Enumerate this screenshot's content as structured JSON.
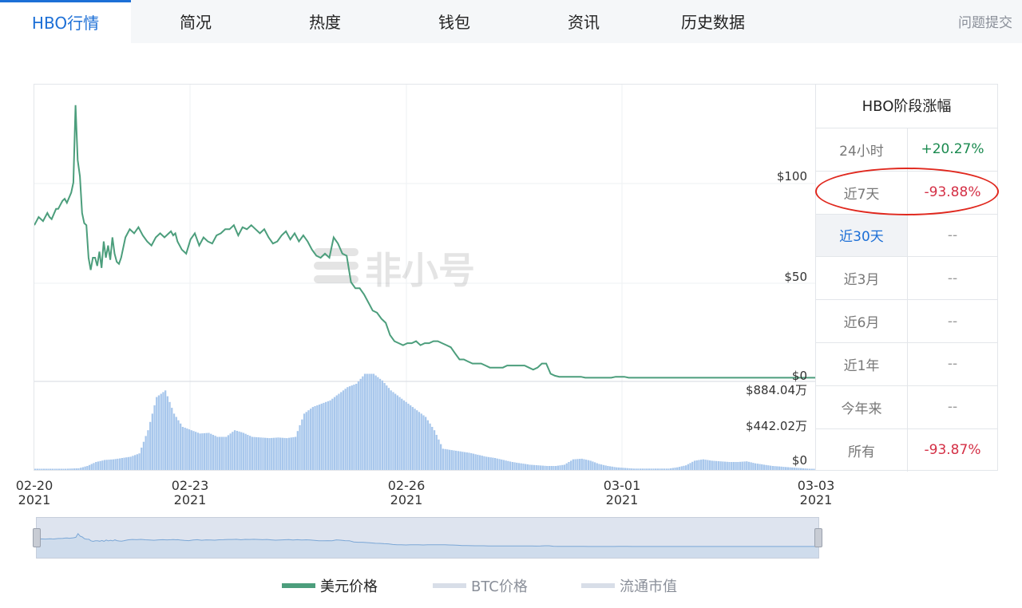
{
  "tabs": [
    {
      "label": "HBO行情",
      "active": true
    },
    {
      "label": "简况",
      "active": false
    },
    {
      "label": "热度",
      "active": false
    },
    {
      "label": "钱包",
      "active": false
    },
    {
      "label": "资讯",
      "active": false
    },
    {
      "label": "历史数据",
      "active": false
    }
  ],
  "feedback_label": "问题提交",
  "watermark": "非小号",
  "colors": {
    "price_line": "#4c9e7c",
    "volume_bar": "#a8c7ec",
    "up": "#1a8a4f",
    "down": "#d42f45",
    "accent": "#1c6fd6"
  },
  "chart_data": {
    "type": "line",
    "price_axis": {
      "ticks": [
        "$100",
        "$50",
        "$0"
      ],
      "values": [
        100,
        50,
        0
      ],
      "ylim": [
        0,
        135
      ]
    },
    "volume_axis": {
      "ticks": [
        "$884.04万",
        "$442.02万",
        "$0"
      ],
      "values": [
        884.04,
        442.02,
        0
      ],
      "unit": "万"
    },
    "x_labels": [
      {
        "date": "02-20",
        "year": "2021"
      },
      {
        "date": "02-23",
        "year": "2021"
      },
      {
        "date": "02-26",
        "year": "2021"
      },
      {
        "date": "03-01",
        "year": "2021"
      },
      {
        "date": "03-03",
        "year": "2021"
      }
    ],
    "x_range": [
      0,
      360
    ],
    "price_series": {
      "name": "美元价格",
      "x": [
        0,
        2,
        4,
        6,
        7,
        8,
        10,
        11,
        12,
        13,
        14,
        15,
        17,
        18,
        19,
        20,
        21,
        22,
        23,
        24,
        25,
        26,
        27,
        28,
        29,
        30,
        31,
        32,
        33,
        34,
        35,
        36,
        37,
        38,
        39,
        40,
        42,
        44,
        46,
        48,
        50,
        52,
        54,
        56,
        58,
        60,
        62,
        63,
        64,
        65,
        66,
        68,
        70,
        72,
        74,
        76,
        78,
        80,
        82,
        84,
        86,
        88,
        90,
        92,
        94,
        96,
        98,
        100,
        102,
        104,
        106,
        108,
        110,
        112,
        114,
        116,
        118,
        120,
        122,
        124,
        126,
        128,
        130,
        132,
        134,
        136,
        138,
        140,
        142,
        144,
        146,
        148,
        150,
        152,
        154,
        156,
        158,
        160,
        162,
        164,
        166,
        168,
        170,
        172,
        174,
        176,
        178,
        180,
        182,
        184,
        186,
        188,
        190,
        192,
        194,
        196,
        198,
        200,
        202,
        204,
        206,
        208,
        210,
        212,
        214,
        216,
        218,
        220,
        222,
        224,
        226,
        228,
        230,
        232,
        234,
        236,
        238,
        240,
        242,
        244,
        246,
        248,
        250,
        252,
        254,
        256,
        258,
        260,
        262,
        264,
        266,
        268,
        270,
        272,
        274,
        276,
        278,
        280,
        282,
        284,
        286,
        288,
        290,
        292,
        294,
        296,
        298,
        300,
        302,
        304,
        306,
        308,
        310,
        312,
        314,
        316,
        318,
        320,
        322,
        324,
        326,
        328,
        330,
        332,
        334,
        336,
        338,
        340,
        342,
        344,
        346,
        348,
        350,
        352,
        354,
        356,
        358,
        360
      ],
      "values": [
        76,
        80,
        78,
        82,
        80,
        79,
        84,
        84,
        86,
        88,
        89,
        87,
        92,
        97,
        135,
        108,
        100,
        82,
        77,
        76,
        60,
        54,
        60,
        60,
        56,
        63,
        55,
        68,
        60,
        66,
        59,
        70,
        62,
        58,
        57,
        60,
        70,
        74,
        72,
        75,
        71,
        68,
        66,
        70,
        72,
        70,
        72,
        73,
        71,
        72,
        68,
        64,
        62,
        69,
        72,
        66,
        70,
        68,
        67,
        71,
        72,
        74,
        74,
        76,
        71,
        75,
        74,
        76,
        74,
        72,
        74,
        70,
        67,
        68,
        71,
        73,
        69,
        72,
        68,
        71,
        68,
        64,
        61,
        60,
        62,
        60,
        70,
        67,
        62,
        61,
        48,
        45,
        45,
        42,
        38,
        34,
        33,
        30,
        28,
        22,
        19,
        18,
        17,
        18,
        18,
        19,
        17,
        18,
        18,
        19,
        19,
        18,
        17,
        16,
        13,
        10,
        10,
        9,
        8,
        8,
        8,
        7,
        6,
        6,
        6,
        6,
        7,
        7,
        7,
        7,
        7,
        6,
        5,
        6,
        8,
        8,
        3,
        2,
        1.5,
        1.5,
        1.5,
        1.5,
        1.5,
        1.5,
        1,
        1,
        1,
        1,
        1,
        1,
        1,
        1.5,
        1.5,
        1.5,
        1,
        1,
        1,
        1,
        1,
        1,
        1,
        1,
        1,
        1,
        1,
        1,
        1,
        1,
        1,
        1,
        1,
        1,
        1,
        1,
        1,
        1,
        1,
        1,
        1,
        1,
        1,
        1,
        1,
        1,
        1,
        1,
        1,
        1,
        1,
        1,
        1,
        1,
        1,
        1,
        1,
        1,
        1,
        1,
        1,
        1
      ]
    },
    "volume_series": {
      "name": "流通市值",
      "x": [
        0,
        4,
        8,
        12,
        16,
        20,
        24,
        28,
        32,
        36,
        40,
        44,
        48,
        52,
        56,
        60,
        64,
        68,
        72,
        76,
        80,
        84,
        88,
        92,
        96,
        100,
        104,
        108,
        112,
        116,
        120,
        124,
        128,
        132,
        136,
        140,
        144,
        148,
        152,
        156,
        160,
        164,
        168,
        172,
        176,
        180,
        184,
        188,
        192,
        196,
        200,
        204,
        208,
        212,
        216,
        220,
        224,
        228,
        232,
        236,
        240,
        244,
        248,
        252,
        256,
        260,
        264,
        268,
        272,
        276,
        280,
        284,
        288,
        292,
        296,
        300,
        304,
        308,
        312,
        316,
        320,
        324,
        328,
        332,
        336,
        340,
        344,
        348,
        352,
        356,
        360
      ],
      "values": [
        10,
        10,
        10,
        15,
        20,
        25,
        60,
        120,
        150,
        160,
        180,
        200,
        250,
        600,
        1100,
        1200,
        850,
        650,
        600,
        550,
        560,
        500,
        500,
        600,
        560,
        500,
        490,
        480,
        490,
        480,
        500,
        850,
        950,
        1000,
        1050,
        1150,
        1250,
        1300,
        1450,
        1450,
        1350,
        1200,
        1100,
        1000,
        900,
        800,
        600,
        320,
        300,
        280,
        260,
        230,
        200,
        180,
        150,
        120,
        100,
        80,
        70,
        60,
        60,
        80,
        160,
        170,
        140,
        90,
        60,
        40,
        30,
        20,
        20,
        20,
        20,
        20,
        40,
        70,
        140,
        160,
        140,
        130,
        120,
        120,
        130,
        100,
        80,
        60,
        50,
        40,
        30,
        20,
        10
      ]
    },
    "volume_max": 1300
  },
  "performance": {
    "title": "HBO阶段涨幅",
    "rows": [
      {
        "period": "24小时",
        "value": "+20.27%",
        "state": "up",
        "active": false
      },
      {
        "period": "近7天",
        "value": "-93.88%",
        "state": "down",
        "active": false
      },
      {
        "period": "近30天",
        "value": "--",
        "state": "none",
        "active": true
      },
      {
        "period": "近3月",
        "value": "--",
        "state": "none",
        "active": false
      },
      {
        "period": "近6月",
        "value": "--",
        "state": "none",
        "active": false
      },
      {
        "period": "近1年",
        "value": "--",
        "state": "none",
        "active": false
      },
      {
        "period": "今年来",
        "value": "--",
        "state": "none",
        "active": false
      },
      {
        "period": "所有",
        "value": "-93.87%",
        "state": "down",
        "active": false
      }
    ]
  },
  "legend": [
    {
      "label": "美元价格",
      "color": "#4c9e7c",
      "text_color": "#222"
    },
    {
      "label": "BTC价格",
      "color": "#d8dee8",
      "text_color": "#8a8f99"
    },
    {
      "label": "流通市值",
      "color": "#d8dee8",
      "text_color": "#8a8f99"
    }
  ]
}
